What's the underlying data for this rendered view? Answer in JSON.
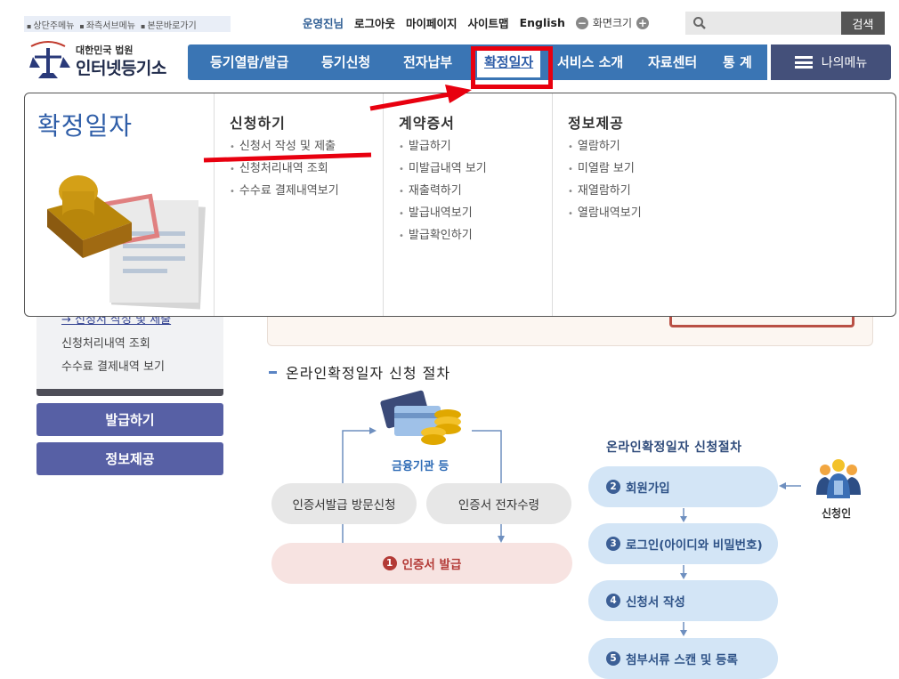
{
  "skip_links": [
    "상단주메뉴",
    "좌측서브메뉴",
    "본문바로가기"
  ],
  "util": {
    "user": "운영진님",
    "logout": "로그아웃",
    "mypage": "마이페이지",
    "sitemap": "사이트맵",
    "english": "English",
    "zoom_label": "화면크기",
    "zoom_out": "−",
    "zoom_in": "+"
  },
  "search": {
    "button": "검색"
  },
  "logo": {
    "sub": "대한민국 법원",
    "main": "인터넷등기소"
  },
  "gnb": [
    "등기열람/발급",
    "등기신청",
    "전자납부",
    "확정일자",
    "서비스 소개",
    "자료센터",
    "통 계"
  ],
  "my_menu": "나의메뉴",
  "mega": {
    "title": "확정일자",
    "columns": [
      {
        "title": "신청하기",
        "items": [
          "신청서 작성 및 제출",
          "신청처리내역 조회",
          "수수료 결제내역보기"
        ]
      },
      {
        "title": "계약증서",
        "items": [
          "발급하기",
          "미발급내역 보기",
          "재출력하기",
          "발급내역보기",
          "발급확인하기"
        ]
      },
      {
        "title": "정보제공",
        "items": [
          "열람하기",
          "미열람 보기",
          "재열람하기",
          "열람내역보기"
        ]
      }
    ]
  },
  "sidebar": {
    "current": "신청서 작성 및 제출",
    "items": [
      "신청처리내역 조회",
      "수수료 결제내역 보기"
    ],
    "buttons": [
      "발급하기",
      "정보제공"
    ]
  },
  "section_title": "온라인확정일자 신청 절차",
  "left_flow": {
    "finance": "금융기관 등",
    "visit": "인증서발급 방문신청",
    "electronic": "인증서 전자수령",
    "issue_num": "1",
    "issue": "인증서 발급"
  },
  "right_flow": {
    "title": "온라인확정일자 신청절차",
    "applicant": "신청인",
    "steps": [
      {
        "num": "2",
        "label": "회원가입"
      },
      {
        "num": "3",
        "label": "로그인(아이디와 비밀번호)"
      },
      {
        "num": "4",
        "label": "신청서 작성"
      },
      {
        "num": "5",
        "label": "첨부서류 스캔 및 등록"
      }
    ]
  },
  "colors": {
    "nav_blue": "#3a75b4",
    "highlight_red": "#e8000f",
    "side_button": "#5760a5"
  }
}
